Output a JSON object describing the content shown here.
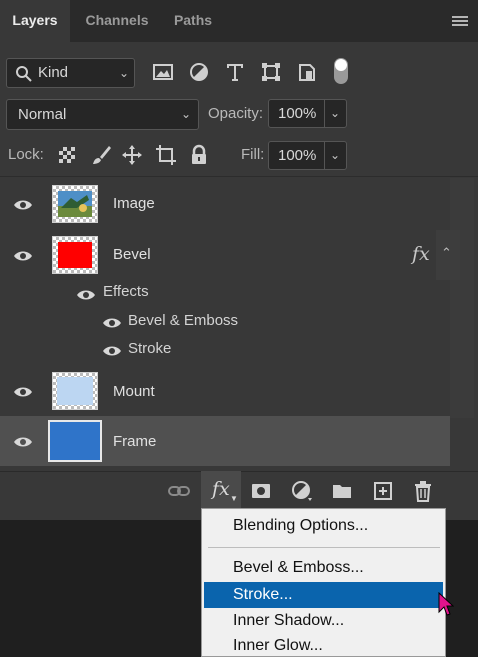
{
  "tabs": [
    {
      "label": "Layers",
      "active": true
    },
    {
      "label": "Channels",
      "active": false
    },
    {
      "label": "Paths",
      "active": false
    }
  ],
  "filter": {
    "kind_label": "Kind"
  },
  "blend": {
    "mode": "Normal",
    "opacity_label": "Opacity:",
    "opacity_value": "100%"
  },
  "lock": {
    "label": "Lock:",
    "fill_label": "Fill:",
    "fill_value": "100%"
  },
  "layers": [
    {
      "name": "Image",
      "thumb": "photo"
    },
    {
      "name": "Bevel",
      "thumb": "red",
      "fx": "fx"
    },
    {
      "name": "Mount",
      "thumb": "lightblue"
    },
    {
      "name": "Frame",
      "thumb": "blue",
      "selected": true
    }
  ],
  "effects": {
    "label": "Effects",
    "items": [
      "Bevel & Emboss",
      "Stroke"
    ]
  },
  "context_menu": {
    "items": [
      "Blending Options...",
      "Bevel & Emboss...",
      "Stroke...",
      "Inner Shadow...",
      "Inner Glow..."
    ],
    "highlighted": "Stroke..."
  },
  "colors": {
    "accent": "#0a64ad",
    "bevel_thumb": "#ff0000",
    "frame_thumb": "#2f74c9",
    "mount_thumb": "#bcd6f2"
  }
}
